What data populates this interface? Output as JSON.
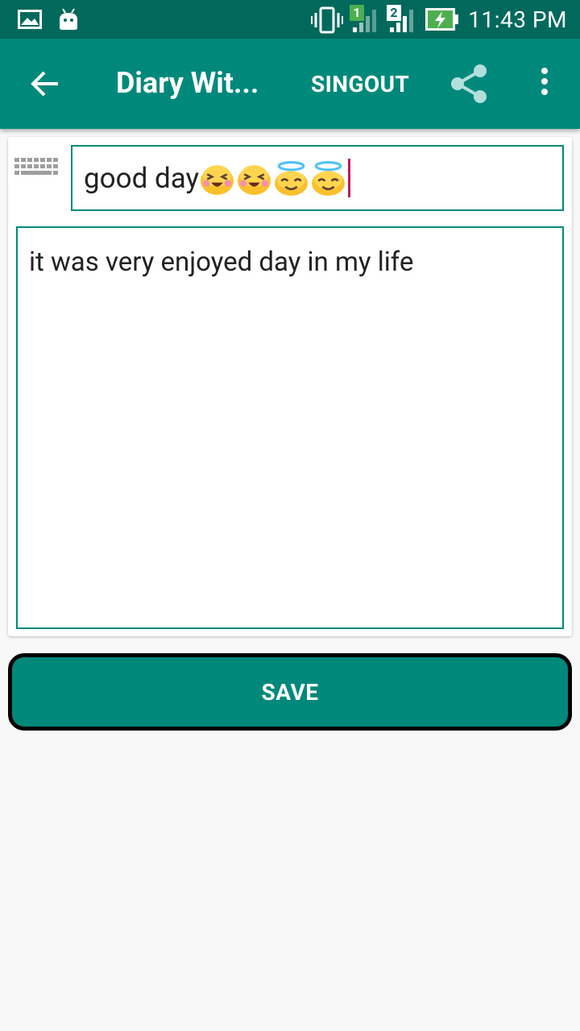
{
  "status_bar": {
    "time": "11:43 PM",
    "icons": [
      "gallery-notification-icon",
      "android-notification-icon",
      "vibrate-icon",
      "signal-sim1-icon",
      "signal-sim2-icon",
      "battery-charging-icon"
    ],
    "sim1_label": "1",
    "sim2_label": "2"
  },
  "app_bar": {
    "title": "Diary Wit...",
    "action_label": "SINGOUT",
    "icons": [
      "back-arrow-icon",
      "share-icon",
      "more-vert-icon"
    ],
    "color": "#00897b",
    "status_color": "#00695c"
  },
  "editor": {
    "title_value": "good day",
    "title_emojis": [
      "squinting-face-emoji",
      "squinting-face-emoji",
      "halo-face-emoji",
      "halo-face-emoji"
    ],
    "body_value": "it was very enjoyed day in my life",
    "keyboard_icon": "keyboard-icon",
    "border_color": "#00897b",
    "caret_color": "#c2185b"
  },
  "save_button": {
    "label": "SAVE"
  }
}
